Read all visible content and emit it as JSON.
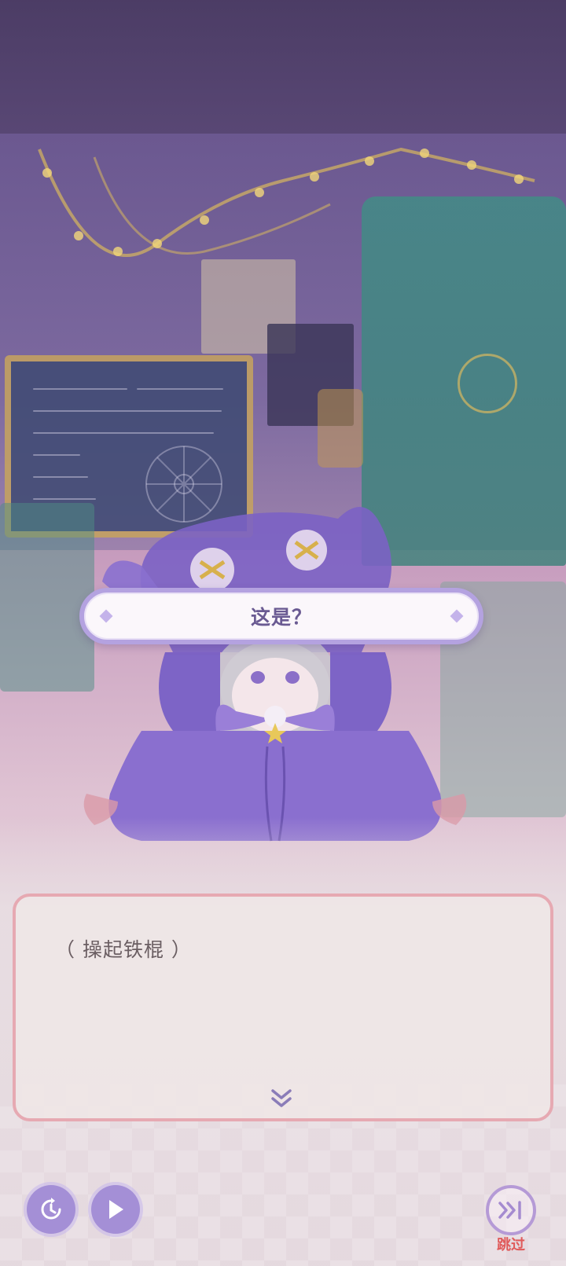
{
  "dialogue": {
    "speaker_line": "这是？",
    "narration": "（ 操起铁棍 ）"
  },
  "controls": {
    "auto_icon": "clock-replay-icon",
    "play_icon": "play-icon",
    "skip_icon": "skip-forward-icon",
    "skip_label": "跳过"
  },
  "colors": {
    "name_plate_border": "#b4a2e0",
    "name_text": "#6a5a92",
    "dialogue_border": "#e6a9b2",
    "control_purple": "#a48fd6",
    "skip_label": "#e05a5a"
  }
}
